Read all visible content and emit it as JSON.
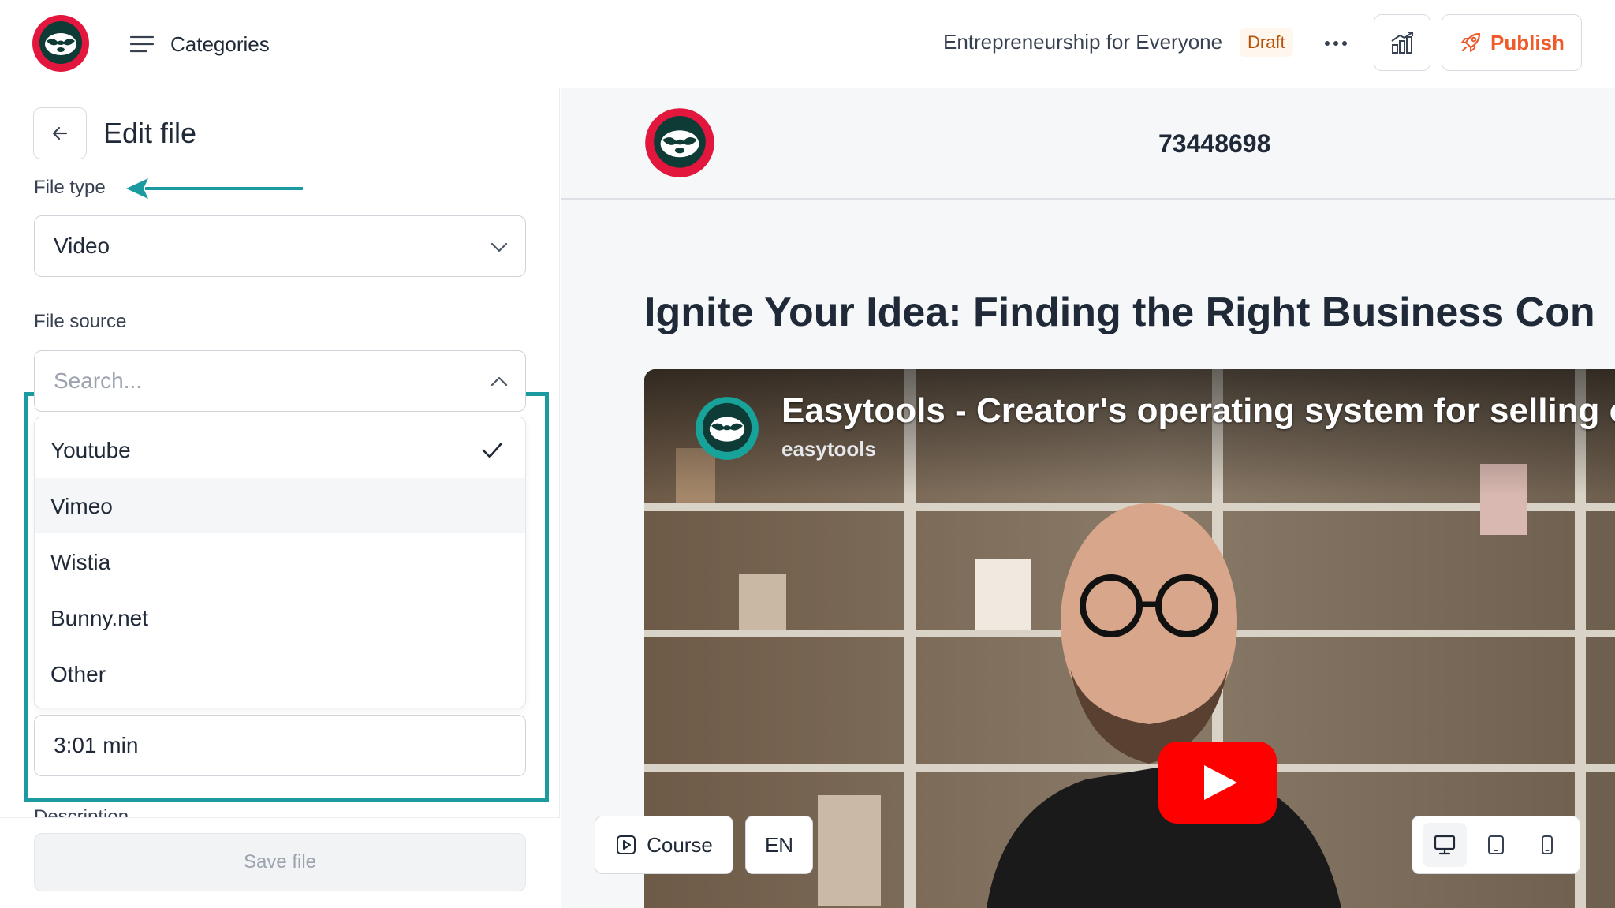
{
  "header": {
    "categories_label": "Categories",
    "course_title": "Entrepreneurship for Everyone",
    "status_badge": "Draft",
    "publish_label": "Publish",
    "brand_color": "#e3173e",
    "accent_color": "#ef5a2a"
  },
  "edit_panel": {
    "title": "Edit file",
    "file_type": {
      "label": "File type",
      "value": "Video"
    },
    "file_source": {
      "label": "File source",
      "search_placeholder": "Search...",
      "options": [
        {
          "label": "Youtube",
          "selected": true
        },
        {
          "label": "Vimeo",
          "selected": false
        },
        {
          "label": "Wistia",
          "selected": false
        },
        {
          "label": "Bunny.net",
          "selected": false
        },
        {
          "label": "Other",
          "selected": false
        }
      ]
    },
    "duration_value": "3:01 min",
    "description_label": "Description",
    "save_label": "Save file",
    "highlight_color": "#1b9aa0"
  },
  "preview": {
    "course_id": "73448698",
    "lesson_title": "Ignite Your Idea: Finding the Right Business Con",
    "video": {
      "title": "Easytools - Creator's operating system for selling o",
      "channel": "easytools"
    },
    "course_button_label": "Course",
    "language_label": "EN",
    "devices": [
      "desktop-icon",
      "tablet-icon",
      "mobile-icon"
    ],
    "active_device": "desktop-icon"
  }
}
